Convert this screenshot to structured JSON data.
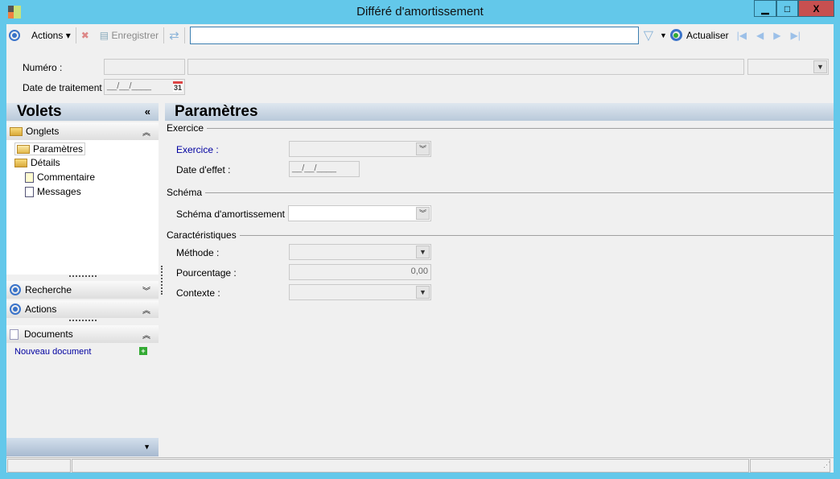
{
  "window": {
    "title": "Différé d'amortissement",
    "minimize": "▁",
    "maximize": "□",
    "close": "X"
  },
  "toolbar": {
    "actions": "Actions",
    "save": "Enregistrer",
    "search_value": "",
    "refresh": "Actualiser"
  },
  "header": {
    "numero_label": "Numéro :",
    "date_label": "Date de traitement :",
    "date_value": "__/__/____",
    "calendar": "31"
  },
  "volets": {
    "title": "Volets",
    "onglets": "Onglets",
    "tree": [
      "Paramètres",
      "Détails",
      "Commentaire",
      "Messages"
    ],
    "recherche": "Recherche",
    "actions": "Actions",
    "documents": "Documents",
    "new_document": "Nouveau document"
  },
  "main": {
    "title": "Paramètres",
    "exercice_group": "Exercice",
    "exercice_label": "Exercice :",
    "date_effet_label": "Date d'effet :",
    "date_effet_value": "__/__/____",
    "schema_group": "Schéma",
    "schema_label": "Schéma d'amortissement :",
    "carac_group": "Caractéristiques",
    "methode_label": "Méthode :",
    "pourcentage_label": "Pourcentage :",
    "pourcentage_value": "0,00",
    "contexte_label": "Contexte :"
  },
  "colors": {
    "frame": "#63c8ea",
    "close": "#c75050",
    "link": "#0000a0"
  }
}
